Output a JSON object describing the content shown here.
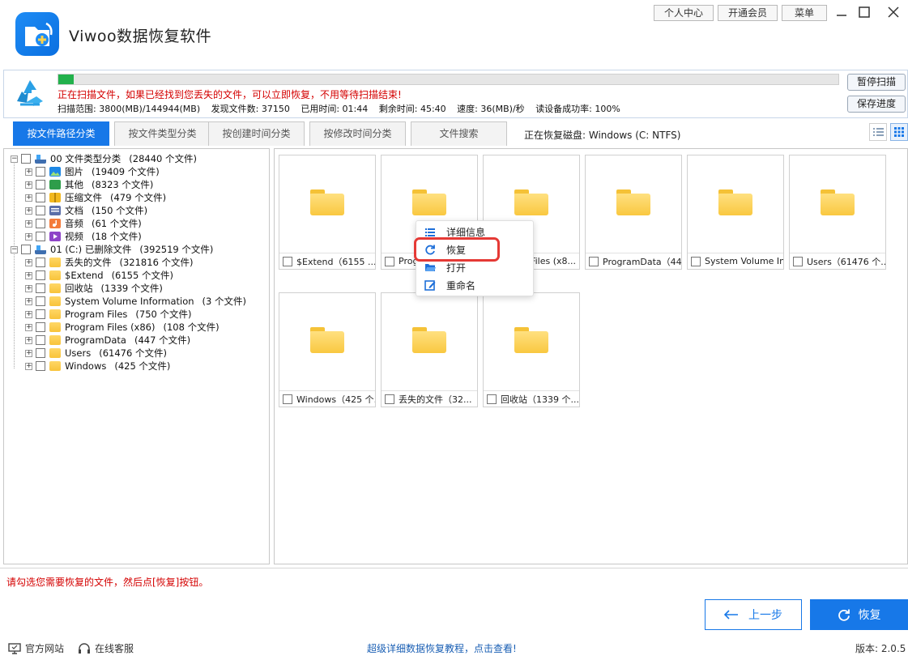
{
  "app": {
    "title": "Viwoo数据恢复软件"
  },
  "top_buttons": {
    "personal_center": "个人中心",
    "membership": "开通会员",
    "menu": "菜单"
  },
  "scan": {
    "progress_fraction": 0.02,
    "message": "正在扫描文件，如果已经找到您丢失的文件，可以立即恢复，不用等待扫描结束!",
    "range": "扫描范围: 3800(MB)/144944(MB)",
    "found": "发现文件数: 37150",
    "elapsed": "已用时间: 01:44",
    "remaining": "剩余时间: 45:40",
    "speed": "速度: 36(MB)/秒",
    "read_success": "读设备成功率: 100%",
    "pause_label": "暂停扫描",
    "save_label": "保存进度"
  },
  "tabs": [
    {
      "label": "按文件路径分类",
      "active": true
    },
    {
      "label": "按文件类型分类",
      "active": false
    },
    {
      "label": "按创建时间分类",
      "active": false
    },
    {
      "label": "按修改时间分类",
      "active": false
    },
    {
      "label": "文件搜索",
      "active": false
    }
  ],
  "disk_status": "正在恢复磁盘: Windows (C: NTFS)",
  "tree": {
    "group1": {
      "label": "00 文件类型分类",
      "count": "(28440 个文件)"
    },
    "group1_items": [
      {
        "label": "图片",
        "count": "(19409 个文件)",
        "icon": "image-icon",
        "color": "#1e88e5"
      },
      {
        "label": "其他",
        "count": "(8323 个文件)",
        "icon": "other-icon",
        "color": "#2e9d4a"
      },
      {
        "label": "压缩文件",
        "count": "(479 个文件)",
        "icon": "archive-icon",
        "color": "#f2b81f"
      },
      {
        "label": "文档",
        "count": "(150 个文件)",
        "icon": "document-icon",
        "color": "#5b6fa8"
      },
      {
        "label": "音频",
        "count": "(61 个文件)",
        "icon": "audio-icon",
        "color": "#f47b3b"
      },
      {
        "label": "视频",
        "count": "(18 个文件)",
        "icon": "video-icon",
        "color": "#8e44c8"
      }
    ],
    "group2": {
      "label": "01 (C:) 已删除文件",
      "count": "(392519 个文件)"
    },
    "group2_items": [
      {
        "label": "丢失的文件",
        "count": "(321816 个文件)"
      },
      {
        "label": "$Extend",
        "count": "(6155 个文件)"
      },
      {
        "label": "回收站",
        "count": "(1339 个文件)"
      },
      {
        "label": "System Volume Information",
        "count": "(3 个文件)"
      },
      {
        "label": "Program Files",
        "count": "(750 个文件)"
      },
      {
        "label": "Program Files (x86)",
        "count": "(108 个文件)"
      },
      {
        "label": "ProgramData",
        "count": "(447 个文件)"
      },
      {
        "label": "Users",
        "count": "(61476 个文件)"
      },
      {
        "label": "Windows",
        "count": "(425 个文件)"
      }
    ]
  },
  "grid": [
    {
      "caption": "$Extend（6155 ..."
    },
    {
      "caption": "Prog"
    },
    {
      "caption": "Files (x8..."
    },
    {
      "caption": "ProgramData（44..."
    },
    {
      "caption": "System Volume In..."
    },
    {
      "caption": "Users（61476 个..."
    },
    {
      "caption": "Windows（425 个..."
    },
    {
      "caption": "丢失的文件（32..."
    },
    {
      "caption": "回收站（1339 个..."
    }
  ],
  "context_menu": {
    "details": "详细信息",
    "recover": "恢复",
    "open": "打开",
    "rename": "重命名"
  },
  "footer": {
    "hint": "请勾选您需要恢复的文件，然后点[恢复]按钮。",
    "back_label": "上一步",
    "recover_label": "恢复",
    "official_site": "官方网站",
    "online_service": "在线客服",
    "tutorial": "超级详细数据恢复教程，点击查看!",
    "version": "版本: 2.0.5"
  },
  "colors": {
    "accent": "#1778e8",
    "progress": "#22b14c",
    "warning_text": "#d40000",
    "highlight": "#e53935"
  }
}
